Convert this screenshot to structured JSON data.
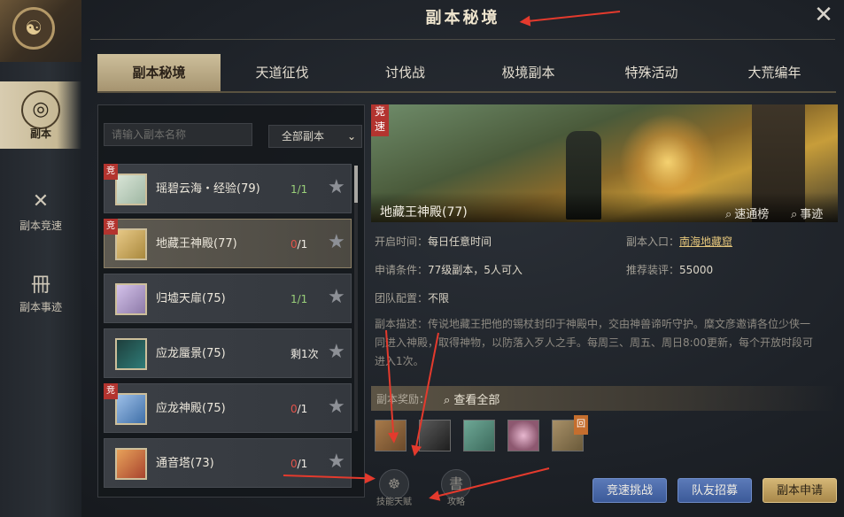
{
  "window": {
    "title": "副本秘境",
    "close_icon": "close-icon"
  },
  "rail": {
    "items": [
      {
        "label": "副本",
        "icon": "dungeon-icon",
        "glyph": "◎"
      },
      {
        "label": "副本竞速",
        "icon": "crossed-swords-icon",
        "glyph": "✕"
      },
      {
        "label": "副本事迹",
        "icon": "chronicle-icon",
        "glyph": "冊"
      }
    ]
  },
  "tabs": [
    "副本秘境",
    "天道征伐",
    "讨伐战",
    "极境副本",
    "特殊活动",
    "大荒编年"
  ],
  "list": {
    "search_placeholder": "请输入副本名称",
    "filter_label": "全部副本",
    "rows": [
      {
        "badge": "竞",
        "name": "瑶碧云海・经验(79)",
        "count": "1/1",
        "count_style": "green",
        "thumb_color": "#9fb7a3"
      },
      {
        "badge": "竞",
        "name": "地藏王神殿(77)",
        "count_num": "0",
        "count_den": "/1",
        "count_style": "red",
        "thumb_color": "#a9893d"
      },
      {
        "badge": "",
        "name": "归墟天扉(75)",
        "count": "1/1",
        "count_style": "green",
        "thumb_color": "#8d7aa8"
      },
      {
        "badge": "",
        "name": "应龙蜃景(75)",
        "count": "剩1次",
        "count_style": "white",
        "thumb_color": "#2f7d78"
      },
      {
        "badge": "竞",
        "name": "应龙神殿(75)",
        "count_num": "0",
        "count_den": "/1",
        "count_style": "red",
        "thumb_color": "#3f6fa8"
      },
      {
        "badge": "",
        "name": "通音塔(73)",
        "count_num": "0",
        "count_den": "/1",
        "count_style": "red",
        "thumb_color": "#a8442e"
      }
    ]
  },
  "detail": {
    "badge": "竞速",
    "name": "地藏王神殿(77)",
    "speed_rank": "速通榜",
    "deeds": "事迹",
    "open_time_label": "开启时间：",
    "open_time": "每日任意时间",
    "entrance_label": "副本入口：",
    "entrance": "南海地藏窟",
    "requirement_label": "申请条件：",
    "requirement": "77级副本，5人可入",
    "recommend_label": "推荐装评：",
    "recommend": "55000",
    "team_label": "团队配置：",
    "team": "不限",
    "description": "副本描述：传说地藏王把他的锡杖封印于神殿中，交由神兽谛听守护。糜文彦邀请各位少侠一同进入神殿，取得神物，以防落入歹人之手。每周三、周五、周日8:00更新，每个开放时段可进入1次。",
    "reward_label": "副本奖励：",
    "view_all": "查看全部",
    "rewards": [
      {
        "icon": "book-reward-icon",
        "color": "#6b4a2b"
      },
      {
        "icon": "scroll-reward-icon",
        "color": "#3a3a3a"
      },
      {
        "icon": "armor-reward-icon",
        "color": "#3c6a5c"
      },
      {
        "icon": "disc-reward-icon",
        "color": "#8d5870"
      },
      {
        "icon": "token-reward-icon",
        "color": "#6a5a3a",
        "tag": "回"
      }
    ],
    "buttons": {
      "speedrun": "竞速挑战",
      "recruit": "队友招募",
      "apply": "副本申请"
    },
    "bottom": [
      {
        "label": "技能天赋",
        "icon": "skill-talent-icon",
        "glyph": "☸"
      },
      {
        "label": "攻略",
        "icon": "strategy-icon",
        "glyph": "書"
      }
    ]
  },
  "colors": {
    "accent_gold": "#cdbf9b",
    "badge_red": "#b3342f",
    "button_blue": "#3c5a99",
    "annotation_arrow": "#e43a2d"
  }
}
